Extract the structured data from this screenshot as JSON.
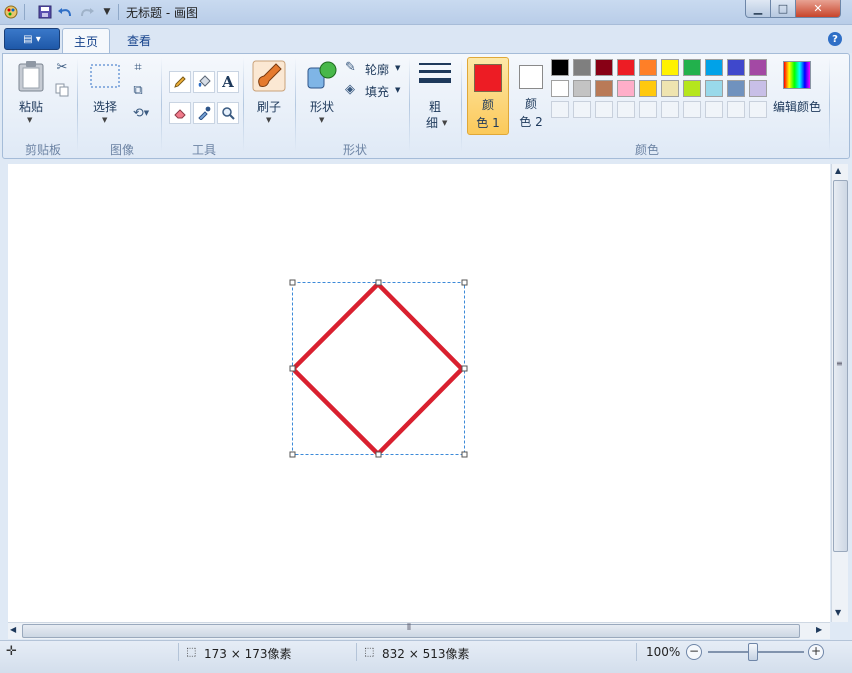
{
  "window": {
    "title": "无标题 - 画图"
  },
  "tabs": [
    {
      "label": "主页"
    },
    {
      "label": "查看"
    }
  ],
  "ribbon": {
    "clipboard": {
      "paste_label": "粘贴",
      "group_label": "剪贴板"
    },
    "image": {
      "select_label": "选择",
      "group_label": "图像"
    },
    "tools": {
      "group_label": "工具",
      "text_tool_glyph": "A"
    },
    "brushes": {
      "label": "刷子"
    },
    "shapes": {
      "shapes_label": "形状",
      "outline_label": "轮廓",
      "fill_label": "填充",
      "group_label": "形状"
    },
    "size": {
      "label_line1": "粗",
      "label_line2": "细"
    },
    "colors": {
      "color1_line1": "颜",
      "color1_line2": "色 1",
      "color1_value": "#ed1c24",
      "color2_line1": "颜",
      "color2_line2": "色 2",
      "color2_value": "#ffffff",
      "edit_colors_label": "编辑颜色",
      "group_label": "颜色",
      "palette_row1": [
        "#000000",
        "#7f7f7f",
        "#880015",
        "#ed1c24",
        "#ff7f27",
        "#fff200",
        "#22b14c",
        "#00a2e8",
        "#3f48cc",
        "#a349a4"
      ],
      "palette_row2": [
        "#ffffff",
        "#c3c3c3",
        "#b97a57",
        "#ffaec9",
        "#ffc90e",
        "#efe4b0",
        "#b5e61d",
        "#99d9ea",
        "#7092be",
        "#c8bfe7"
      ]
    }
  },
  "canvas": {
    "shape": "diamond",
    "stroke_color": "#d9202f"
  },
  "statusbar": {
    "selection_size": "173 × 173像素",
    "canvas_size": "832 × 513像素",
    "zoom": "100%",
    "zoom_level_percent": 100
  },
  "icons": {
    "app": "paint-app-icon",
    "save": "save-icon",
    "undo": "undo-icon",
    "redo": "redo-icon",
    "help": "help-icon"
  }
}
